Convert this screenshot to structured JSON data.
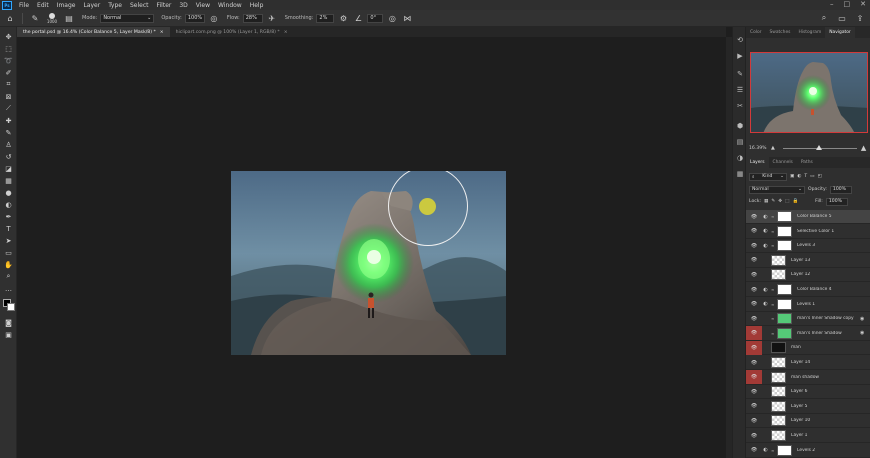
{
  "menubar": {
    "logo": "Ps",
    "items": [
      "File",
      "Edit",
      "Image",
      "Layer",
      "Type",
      "Select",
      "Filter",
      "3D",
      "View",
      "Window",
      "Help"
    ],
    "win_ctrls": [
      "–",
      "□",
      "✕"
    ]
  },
  "options": {
    "brush_size": "1000",
    "mode_label": "Mode:",
    "mode_value": "Normal",
    "opacity_label": "Opacity:",
    "opacity_value": "100%",
    "flow_label": "Flow:",
    "flow_value": "28%",
    "smoothing_label": "Smoothing:",
    "smoothing_value": "2%",
    "angle_value": "0°"
  },
  "tabs": [
    {
      "label": "the portal.psd @ 16.4% (Color Balance 5, Layer Mask/8) *",
      "close": "×"
    },
    {
      "label": "hiclipart.com.png @ 100% (Layer 1, RGB/8) *",
      "close": "×"
    }
  ],
  "panels": {
    "top_tabs": [
      "Color",
      "Swatches",
      "Histogram",
      "Navigator"
    ],
    "zoom": "16.39%",
    "layer_tabs": [
      "Layers",
      "Channels",
      "Paths"
    ],
    "filter_kind": "Kind",
    "blend_mode": "Normal",
    "opacity_label": "Opacity:",
    "opacity_value": "100%",
    "lock_label": "Lock:",
    "fill_label": "Fill:",
    "fill_value": "100%"
  },
  "layers": [
    {
      "name": "Color Balance 5",
      "adj": "◐",
      "thumb": "white",
      "eye_red": false,
      "selected": true,
      "fx": ""
    },
    {
      "name": "Selective Color 1",
      "adj": "◐",
      "thumb": "white",
      "eye_red": false,
      "selected": false,
      "fx": ""
    },
    {
      "name": "Levels 3",
      "adj": "◐",
      "thumb": "white",
      "eye_red": false,
      "selected": false,
      "fx": ""
    },
    {
      "name": "Layer 13",
      "adj": "",
      "thumb": "checker",
      "eye_red": false,
      "selected": false,
      "fx": ""
    },
    {
      "name": "Layer 12",
      "adj": "",
      "thumb": "checker",
      "eye_red": false,
      "selected": false,
      "fx": ""
    },
    {
      "name": "Color Balance 4",
      "adj": "◐",
      "thumb": "white",
      "eye_red": false,
      "selected": false,
      "fx": ""
    },
    {
      "name": "Levels 1",
      "adj": "◐",
      "thumb": "white",
      "eye_red": false,
      "selected": false,
      "fx": ""
    },
    {
      "name": "man's Inner Shadow copy",
      "adj": "",
      "thumb": "green",
      "eye_red": false,
      "selected": false,
      "fx": "◉"
    },
    {
      "name": "man's Inner Shadow",
      "adj": "",
      "thumb": "green",
      "eye_red": true,
      "selected": false,
      "fx": "◉"
    },
    {
      "name": "man",
      "adj": "",
      "thumb": "black",
      "eye_red": true,
      "selected": false,
      "fx": ""
    },
    {
      "name": "Layer 14",
      "adj": "",
      "thumb": "checker",
      "eye_red": false,
      "selected": false,
      "fx": ""
    },
    {
      "name": "man shadow",
      "adj": "",
      "thumb": "checker",
      "eye_red": true,
      "selected": false,
      "fx": ""
    },
    {
      "name": "Layer 6",
      "adj": "",
      "thumb": "checker",
      "eye_red": false,
      "selected": false,
      "fx": ""
    },
    {
      "name": "Layer 5",
      "adj": "",
      "thumb": "checker",
      "eye_red": false,
      "selected": false,
      "fx": ""
    },
    {
      "name": "Layer 10",
      "adj": "",
      "thumb": "checker",
      "eye_red": false,
      "selected": false,
      "fx": ""
    },
    {
      "name": "Layer 1",
      "adj": "",
      "thumb": "checker",
      "eye_red": false,
      "selected": false,
      "fx": ""
    },
    {
      "name": "Levels 2",
      "adj": "◐",
      "thumb": "white",
      "eye_red": false,
      "selected": false,
      "fx": ""
    }
  ],
  "tools": [
    "move-icon",
    "marquee-icon",
    "lasso-icon",
    "quick-select-icon",
    "crop-icon",
    "frame-icon",
    "eyedropper-icon",
    "healing-icon",
    "brush-icon",
    "stamp-icon",
    "history-brush-icon",
    "eraser-icon",
    "gradient-icon",
    "blur-icon",
    "dodge-icon",
    "pen-icon",
    "type-icon",
    "path-select-icon",
    "shape-icon",
    "hand-icon",
    "zoom-icon",
    "more-icon"
  ],
  "colors": {
    "glow": "#3cff6a",
    "brush_cursor": "#d7d236",
    "eye_red": "#a23a36"
  }
}
